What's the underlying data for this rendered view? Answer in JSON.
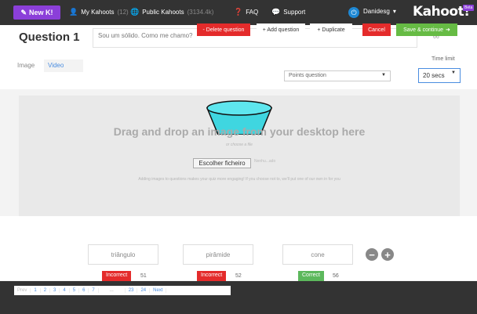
{
  "nav": {
    "new_kahoot": "New K!",
    "my_kahoots": "My Kahoots",
    "my_kahoots_count": "(12)",
    "public_kahoots": "Public Kahoots",
    "public_kahoots_count": "(3134.4k)",
    "faq": "FAQ",
    "support": "Support",
    "username": "Danidesg",
    "logo": "Kahoot!",
    "beta": "Beta"
  },
  "question": {
    "title": "Question 1",
    "text": "Sou um sólido. Como me chamo?",
    "char_count": "66"
  },
  "media": {
    "tab_image": "Image",
    "tab_video": "Video",
    "points_selected": "Points question",
    "time_limit_label": "Time limit",
    "time_limit_selected": "20 secs"
  },
  "dropzone": {
    "title": "Drag and drop an image from your desktop here",
    "or_text": "or choose a file",
    "file_button": "Escolher ficheiro",
    "no_file": "Nenhu...ado",
    "hint": "Adding images to questions makes your quiz more engaging! If you choose not to, we'll put one of our own in for you"
  },
  "answers": [
    {
      "text": "triângulo",
      "status": "Incorrect",
      "count": "51"
    },
    {
      "text": "pirâmide",
      "status": "Incorrect",
      "count": "52"
    },
    {
      "text": "cone",
      "status": "Correct",
      "count": "56"
    }
  ],
  "pager": {
    "prev": "Prev",
    "pages": [
      "1",
      "2",
      "3",
      "4",
      "5",
      "6",
      "7"
    ],
    "dots": "...",
    "page_23": "23",
    "page_24": "24",
    "next": "Next"
  },
  "actions": {
    "delete": "- Delete question",
    "add": "+ Add question",
    "duplicate": "+ Duplicate",
    "cancel": "Cancel",
    "save": "Save & continue"
  },
  "colors": {
    "nav_bg": "#333333",
    "brand_purple": "#8b3fd9",
    "accent_blue": "#4a8de0",
    "incorrect_red": "#e42b2b",
    "correct_green": "#5cb85c",
    "save_green": "#66bb44"
  },
  "icons": {
    "user_icon": "person",
    "globe_icon": "globe",
    "faq_icon": "question-circle",
    "support_icon": "speech-bubble",
    "power_icon": "power",
    "remove_icon": "minus-circle",
    "add_icon": "plus-circle"
  }
}
